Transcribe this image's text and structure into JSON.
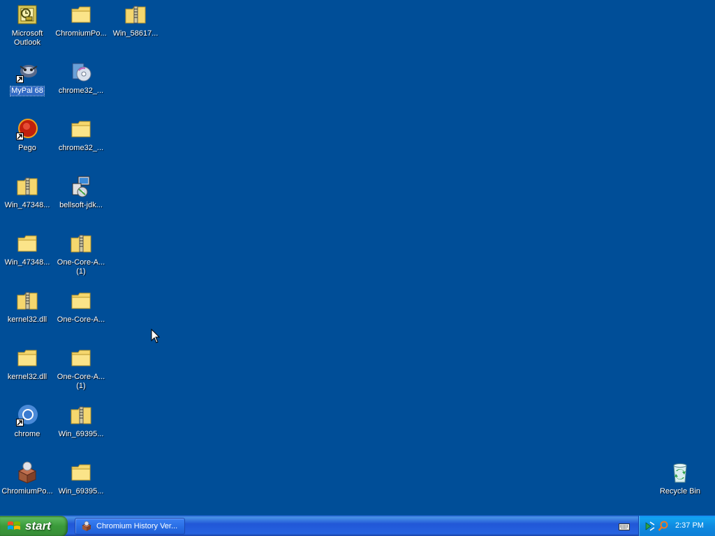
{
  "desktop": {
    "background_color": "#004e98",
    "icons": {
      "microsoft_outlook": "Microsoft\nOutlook",
      "chromium_portable_folder": "ChromiumPo...",
      "win_58617": "Win_58617...",
      "mypal68": "MyPal 68",
      "chrome32_installer": "chrome32_...",
      "pego": "Pego",
      "chrome32_folder": "chrome32_...",
      "win_47348_zip": "Win_47348...",
      "bellsoft_jdk": "bellsoft-jdk...",
      "win_47348_folder": "Win_47348...",
      "one_core_zip_1": "One-Core-A...\n(1)",
      "kernel32_zip": "kernel32.dll",
      "one_core_folder": "One-Core-A...",
      "kernel32_folder": "kernel32.dll",
      "one_core_folder_1": "One-Core-A...\n(1)",
      "chrome": "chrome",
      "win_69395_zip": "Win_69395...",
      "chromium_portable": "ChromiumPo...",
      "win_69395_folder": "Win_69395...",
      "recycle_bin": "Recycle Bin"
    }
  },
  "taskbar": {
    "start_label": "start",
    "task_button_label": "Chromium History Ver...",
    "clock": "2:37 PM"
  },
  "colors": {
    "taskbar_blue": "#2157d7",
    "start_green": "#3a9a3a",
    "tray_blue": "#0f8ae0",
    "folder_yellow": "#f5d76e"
  }
}
